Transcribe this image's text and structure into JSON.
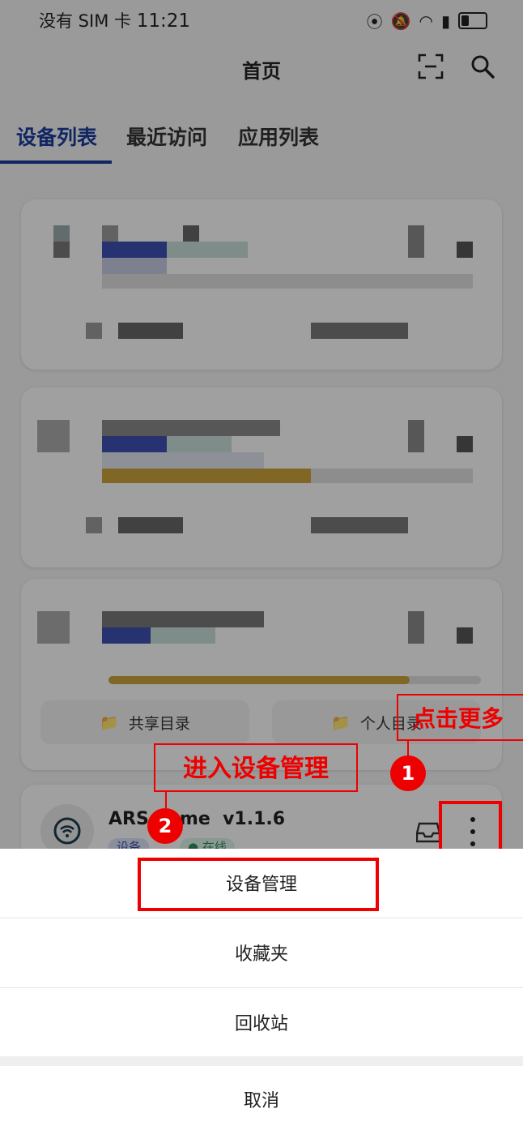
{
  "status_bar": {
    "carrier": "没有 SIM 卡",
    "time": "11:21",
    "battery_icon": "battery-icon"
  },
  "header": {
    "title": "首页",
    "scan_icon": "scan-icon",
    "search_icon": "search-icon"
  },
  "tabs": [
    {
      "label": "设备列表",
      "active": true
    },
    {
      "label": "最近访问",
      "active": false
    },
    {
      "label": "应用列表",
      "active": false
    }
  ],
  "device_cards": {
    "shared_dir_label": "共享目录",
    "personal_dir_label": "个人目录",
    "device_name": "ARS   ome  v1.1.6",
    "badge_device": "设备",
    "badge_online": "● 在线",
    "progress": [
      0.0,
      0.55,
      0.8
    ]
  },
  "annotations": {
    "step1_label": "点击更多",
    "step2_label": "进入设备管理",
    "step1_number": "1",
    "step2_number": "2",
    "color": "#e00000"
  },
  "sheet": {
    "items": [
      "设备管理",
      "收藏夹",
      "回收站"
    ],
    "cancel": "取消"
  }
}
